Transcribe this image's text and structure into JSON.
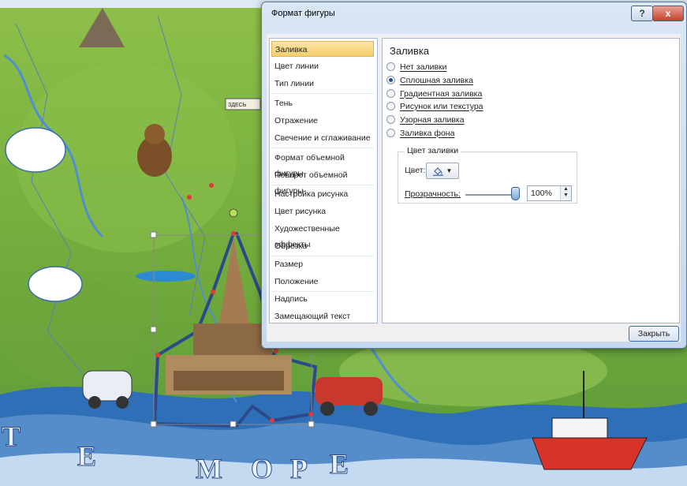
{
  "dialog": {
    "title": "Формат фигуры",
    "help_label": "?",
    "close_x_label": "x",
    "close_button_label": "Закрыть"
  },
  "nav": {
    "items": [
      {
        "label": "Заливка",
        "selected": true
      },
      {
        "label": "Цвет линии"
      },
      {
        "label": "Тип линии"
      },
      {
        "label": "Тень"
      },
      {
        "label": "Отражение"
      },
      {
        "label": "Свечение и сглаживание"
      },
      {
        "label": "Формат объемной фигуры"
      },
      {
        "label": "Поворот объемной фигуры"
      },
      {
        "label": "Настройка рисунка"
      },
      {
        "label": "Цвет рисунка"
      },
      {
        "label": "Художественные эффекты"
      },
      {
        "label": "Обрезка"
      },
      {
        "label": "Размер"
      },
      {
        "label": "Положение"
      },
      {
        "label": "Надпись"
      },
      {
        "label": "Замещающий текст"
      }
    ]
  },
  "fill": {
    "heading": "Заливка",
    "options": [
      {
        "label": "Нет заливки",
        "checked": false
      },
      {
        "label": "Сплошная заливка",
        "checked": true
      },
      {
        "label": "Градиентная заливка",
        "checked": false
      },
      {
        "label": "Рисунок или текстура",
        "checked": false
      },
      {
        "label": "Узорная заливка",
        "checked": false
      },
      {
        "label": "Заливка фона",
        "checked": false
      }
    ],
    "color_group": {
      "title": "Цвет заливки",
      "color_label": "Цвет:",
      "transparency_label": "Прозрачность:",
      "transparency_value": "100%",
      "transparency_fraction": 1.0
    }
  },
  "colors": {
    "selected_nav": "#f5cf6a",
    "sea": "#2f6fb7",
    "land": "#79b13f",
    "shape_outline": "#2b4a8a"
  },
  "map_text": {
    "sea_letters": [
      "Т",
      "Е",
      "М",
      "О",
      "Р",
      "Е"
    ],
    "sign": "ЗДЕСЬ"
  }
}
